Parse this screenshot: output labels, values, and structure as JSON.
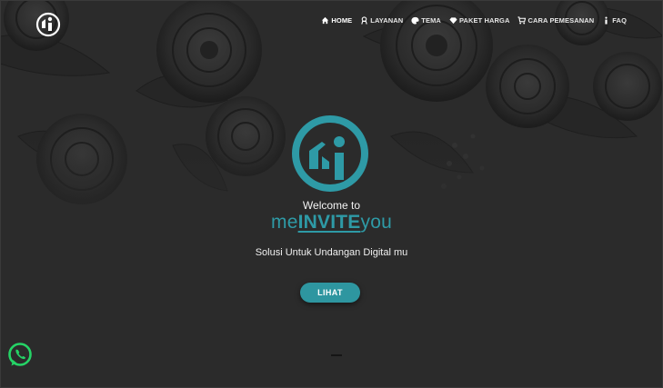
{
  "nav": {
    "items": [
      {
        "label": "HOME",
        "icon": "home-icon",
        "active": true
      },
      {
        "label": "LAYANAN",
        "icon": "service-icon",
        "active": false
      },
      {
        "label": "TEMA",
        "icon": "palette-icon",
        "active": false
      },
      {
        "label": "PAKET HARGA",
        "icon": "diamond-icon",
        "active": false
      },
      {
        "label": "CARA PEMESANAN",
        "icon": "cart-icon",
        "active": false
      },
      {
        "label": "FAQ",
        "icon": "info-icon",
        "active": false
      }
    ]
  },
  "hero": {
    "welcome": "Welcome to",
    "brand_prefix": "me",
    "brand_middle": "INVITE",
    "brand_suffix": "you",
    "tagline": "Solusi Untuk Undangan Digital mu",
    "cta_label": "LIHAT"
  },
  "colors": {
    "accent": "#2e9aa6",
    "background": "#2b2b2b",
    "whatsapp": "#25d366"
  }
}
